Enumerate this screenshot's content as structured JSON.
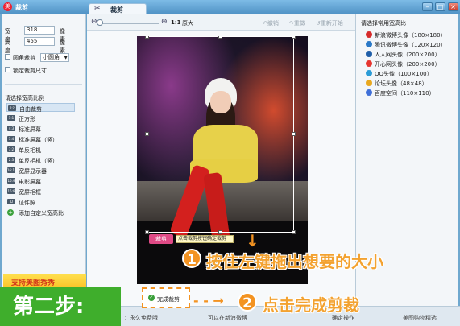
{
  "app": {
    "title": "裁剪",
    "icon": "meitu-icon"
  },
  "tab": {
    "label": "裁剪",
    "icon": "scissors-icon"
  },
  "size": {
    "width_label": "宽度",
    "width_value": "318",
    "height_label": "高度",
    "height_value": "455",
    "unit": "像素"
  },
  "options": {
    "round_crop": "圆角裁剪",
    "round_select": "小圆角",
    "lock_size": "锁定裁剪尺寸"
  },
  "ratio": {
    "title": "请选择宽高比例",
    "items": [
      {
        "icon": "?:?",
        "label": "自由裁剪"
      },
      {
        "icon": "1:1",
        "label": "正方形"
      },
      {
        "icon": "4:3",
        "label": "标准屏幕"
      },
      {
        "icon": "3:4",
        "label": "标准屏幕（竖）"
      },
      {
        "icon": "3:2",
        "label": "单反相机"
      },
      {
        "icon": "2:3",
        "label": "单反相机（竖）"
      },
      {
        "icon": "16:10",
        "label": "宽屏显示器"
      },
      {
        "icon": "16:9",
        "label": "电影屏幕"
      },
      {
        "icon": "16:9",
        "label": "宽屏相框"
      },
      {
        "icon": "ID",
        "label": "证件照"
      },
      {
        "icon": "+",
        "label": "添加自定义宽高比"
      }
    ]
  },
  "promo": {
    "label": "支持美图秀秀"
  },
  "toolbar": {
    "zoom_ratio": "1:1",
    "original": "原大",
    "undo": "撤销",
    "redo": "重做",
    "reset": "重新开始"
  },
  "crop": {
    "button": "裁剪",
    "tip": "点击裁剪按钮确定裁剪"
  },
  "presets": {
    "title": "请选择常用宽高比",
    "items": [
      {
        "label": "新浪微博头像（180×180）",
        "color": "#d62b2b"
      },
      {
        "label": "腾讯微博头像（120×120）",
        "color": "#2a78c6"
      },
      {
        "label": "人人网头像（200×200）",
        "color": "#1f5ea8"
      },
      {
        "label": "开心网头像（200×200）",
        "color": "#e6352f"
      },
      {
        "label": "QQ头像（100×100）",
        "color": "#2b9bd6"
      },
      {
        "label": "论坛头像（48×48）",
        "color": "#e9a81f"
      },
      {
        "label": "百度空间（110×110）",
        "color": "#3f6fd8"
      }
    ]
  },
  "annotations": {
    "step1_num": "1",
    "step1_text": "按住左键拖出想要的大小",
    "step2_num": "2",
    "step2_text": "点击完成剪裁",
    "step_badge": "第二步:"
  },
  "finish": {
    "label": "完成裁剪"
  },
  "status": {
    "left": "：永久免费哦",
    "mid": "可以在新浪微博",
    "right1": "确定操作",
    "right2": "美图购物精选"
  }
}
